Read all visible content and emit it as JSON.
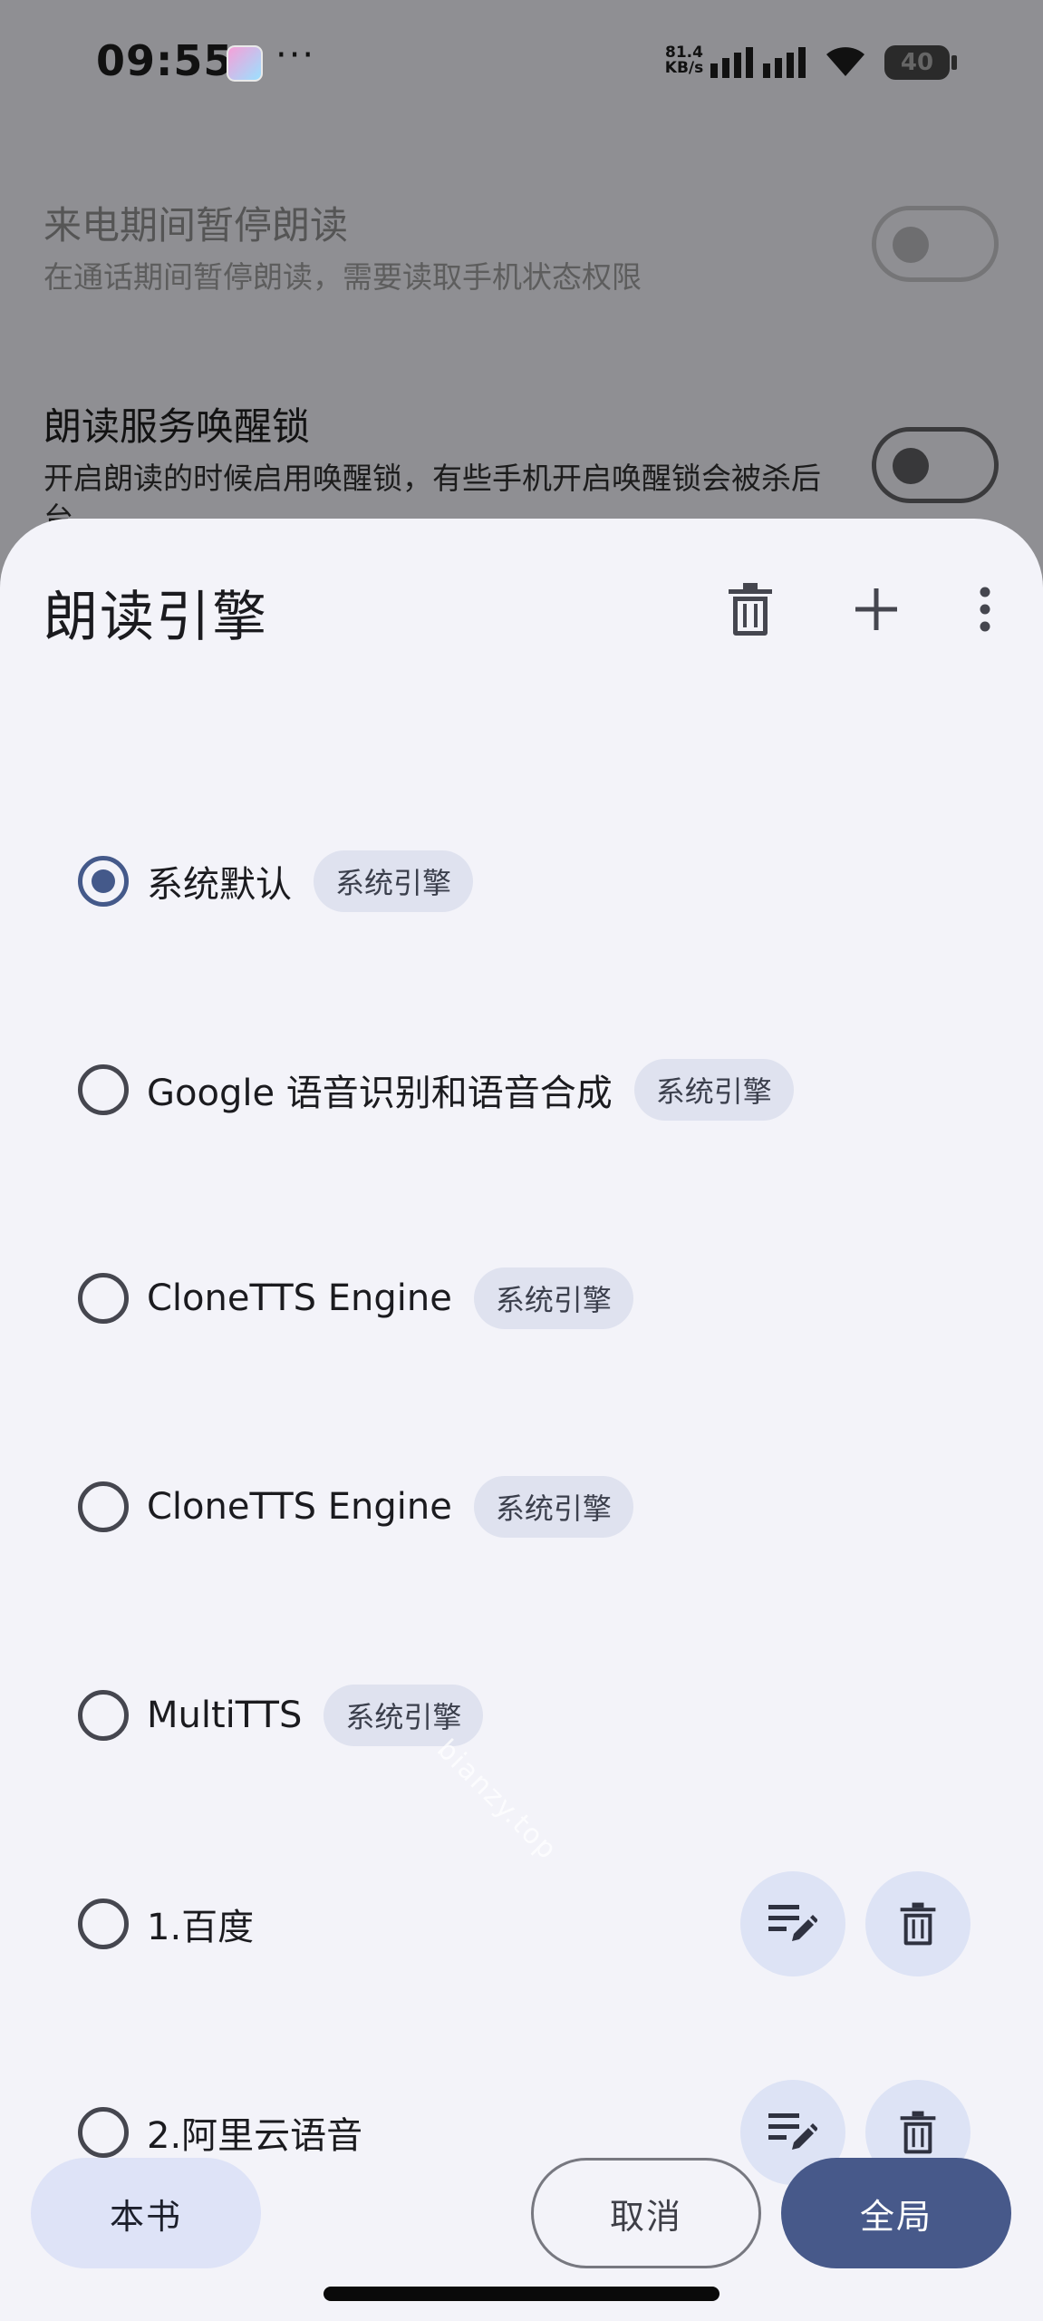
{
  "status_bar": {
    "time": "09:55",
    "more": "···",
    "net_speed_value": "81.4",
    "net_speed_unit": "KB/s",
    "battery": "40"
  },
  "background_settings": [
    {
      "title": "来电期间暂停朗读",
      "desc": "在通话期间暂停朗读，需要读取手机状态权限",
      "enabled": false
    },
    {
      "title": "朗读服务唤醒锁",
      "desc": "开启朗读的时候启用唤醒锁，有些手机开启唤醒锁会被杀后台",
      "enabled": false
    }
  ],
  "sheet": {
    "title": "朗读引擎",
    "engines": [
      {
        "name": "系统默认",
        "tag": "系统引擎",
        "selected": true
      },
      {
        "name": "Google 语音识别和语音合成",
        "tag": "系统引擎",
        "selected": false
      },
      {
        "name": "CloneTTS Engine",
        "tag": "系统引擎",
        "selected": false
      },
      {
        "name": "CloneTTS Engine",
        "tag": "系统引擎",
        "selected": false
      },
      {
        "name": "MultiTTS",
        "tag": "系统引擎",
        "selected": false
      },
      {
        "name": "1.百度",
        "tag": "",
        "selected": false
      },
      {
        "name": "2.阿里云语音",
        "tag": "",
        "selected": false
      }
    ],
    "watermark": "bianzy.top",
    "buttons": {
      "book": "本书",
      "cancel": "取消",
      "global": "全局"
    }
  },
  "colors": {
    "accent": "#47598A",
    "chip": "#DFE2EF",
    "sheet_bg": "#F3F3F9",
    "scrim": "#8F8F93"
  },
  "icons": {
    "delete": "trash-icon",
    "add": "plus-icon",
    "more": "more-vertical-icon",
    "edit": "edit-list-icon"
  }
}
